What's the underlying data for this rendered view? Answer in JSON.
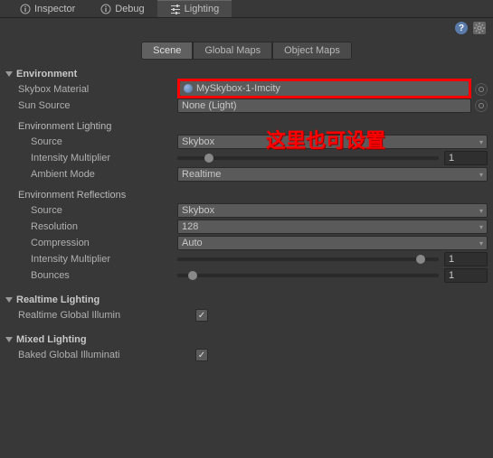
{
  "topTabs": {
    "inspector": "Inspector",
    "debug": "Debug",
    "lighting": "Lighting"
  },
  "subTabs": {
    "scene": "Scene",
    "globalMaps": "Global Maps",
    "objectMaps": "Object Maps"
  },
  "environment": {
    "header": "Environment",
    "skyboxMaterial": {
      "label": "Skybox Material",
      "value": "MySkybox-1-Imcity"
    },
    "sunSource": {
      "label": "Sun Source",
      "value": "None (Light)"
    },
    "lighting": {
      "header": "Environment Lighting",
      "source": {
        "label": "Source",
        "value": "Skybox"
      },
      "intensity": {
        "label": "Intensity Multiplier",
        "value": "1",
        "pos": 12
      },
      "ambientMode": {
        "label": "Ambient Mode",
        "value": "Realtime"
      }
    },
    "reflections": {
      "header": "Environment Reflections",
      "source": {
        "label": "Source",
        "value": "Skybox"
      },
      "resolution": {
        "label": "Resolution",
        "value": "128"
      },
      "compression": {
        "label": "Compression",
        "value": "Auto"
      },
      "intensity": {
        "label": "Intensity Multiplier",
        "value": "1",
        "pos": 93
      },
      "bounces": {
        "label": "Bounces",
        "value": "1",
        "pos": 6
      }
    }
  },
  "realtime": {
    "header": "Realtime Lighting",
    "globalIllum": {
      "label": "Realtime Global Illumin"
    }
  },
  "mixed": {
    "header": "Mixed Lighting",
    "bakedGI": {
      "label": "Baked Global Illuminati"
    }
  },
  "annotation": "这里也可设置"
}
